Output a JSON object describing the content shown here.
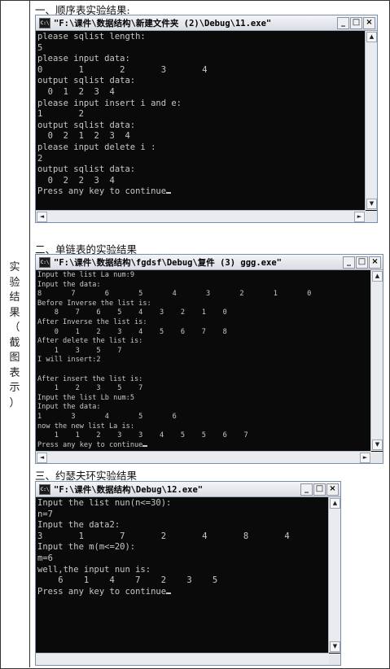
{
  "side_label": [
    "实",
    "验",
    "结",
    "果",
    "（",
    "截",
    "图",
    "表",
    "示",
    "）"
  ],
  "sections": [
    {
      "title": "一、顺序表实验结果:",
      "window_title": "\"F:\\课件\\数据结构\\新建文件夹 (2)\\Debug\\11.exe\"",
      "icon": "console-app-icon",
      "lines": [
        "please sqlist length:",
        "5",
        "please input data:",
        "0       1       2       3       4",
        "output sqlist data:",
        "  0  1  2  3  4",
        "please input insert i and e:",
        "1       2",
        "output sqlist data:",
        "  0  2  1  2  3  4",
        "please input delete i :",
        "2",
        "output sqlist data:",
        "  0  2  2  3  4",
        "Press any key to continue"
      ]
    },
    {
      "title": "二、单链表的实验结果",
      "window_title": "\"F:\\课件\\数据结构\\fgdsf\\Debug\\复件 (3) ggg.exe\"",
      "icon": "console-app-icon",
      "lines": [
        "Input the list La num:9",
        "Input the data:",
        "8       7       6       5       4       3       2       1       0",
        "Before Inverse the list is:",
        "    8    7    6    5    4    3    2    1    0",
        "After Inverse the list is:",
        "    0    1    2    3    4    5    6    7    8",
        "After delete the list is:",
        "    1    3    5    7",
        "I will insert:2",
        "",
        "After insert the list is:",
        "    1    2    3    5    7",
        "Input the list Lb num:5",
        "Input the data:",
        "1       3       4       5       6",
        "now the new list La is:",
        "    1    1    2    3    3    4    5    5    6    7",
        "Press any key to continue"
      ]
    },
    {
      "title": "三、约瑟夫环实验结果",
      "window_title": "\"F:\\课件\\数据结构\\Debug\\12.exe\"",
      "icon": "console-app-icon",
      "lines": [
        "Input the list nun(n<=30):",
        "n=7",
        "Input the data2:",
        "3       1       7       2       4       8       4",
        "Input the m(m<=20):",
        "m=6",
        "well,the input nun is:",
        "    6    1    4    7    2    3    5",
        "Press any key to continue"
      ]
    }
  ],
  "window_buttons": {
    "minimize": "_",
    "maximize": "□",
    "close": "×"
  },
  "scroll": {
    "up": "▲",
    "down": "▼",
    "left": "◄",
    "right": "►"
  }
}
